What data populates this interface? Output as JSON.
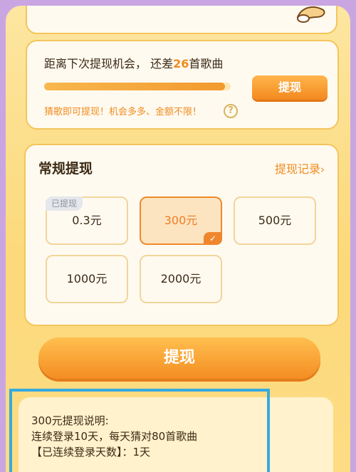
{
  "progress": {
    "title_prefix": "距离下次提现机会，  还差",
    "remaining": "26",
    "title_suffix": "首歌曲",
    "fill_fraction": 0.97,
    "button_label": "提现",
    "hint": "猜歌即可提现！机会多多、金额不限！",
    "help_icon_glyph": "?"
  },
  "withdraw": {
    "title": "常规提现",
    "record_link": "提现记录",
    "record_chevron": "›",
    "options": [
      {
        "label": "0.3元",
        "badge": "已提现",
        "selected": false
      },
      {
        "label": "300元",
        "selected": true
      },
      {
        "label": "500元",
        "selected": false
      },
      {
        "label": "1000元",
        "selected": false
      },
      {
        "label": "2000元",
        "selected": false
      }
    ],
    "check_glyph": "✓"
  },
  "main_button": {
    "label": "提现"
  },
  "info": {
    "line1": "300元提现说明:",
    "line2": "连续登录10天，每天猜对80首歌曲",
    "line3": "【已连续登录天数】：1天"
  },
  "colors": {
    "accent": "#ef8b1f",
    "highlight_border": "#37a9e1",
    "background": "#c9a6e2"
  }
}
